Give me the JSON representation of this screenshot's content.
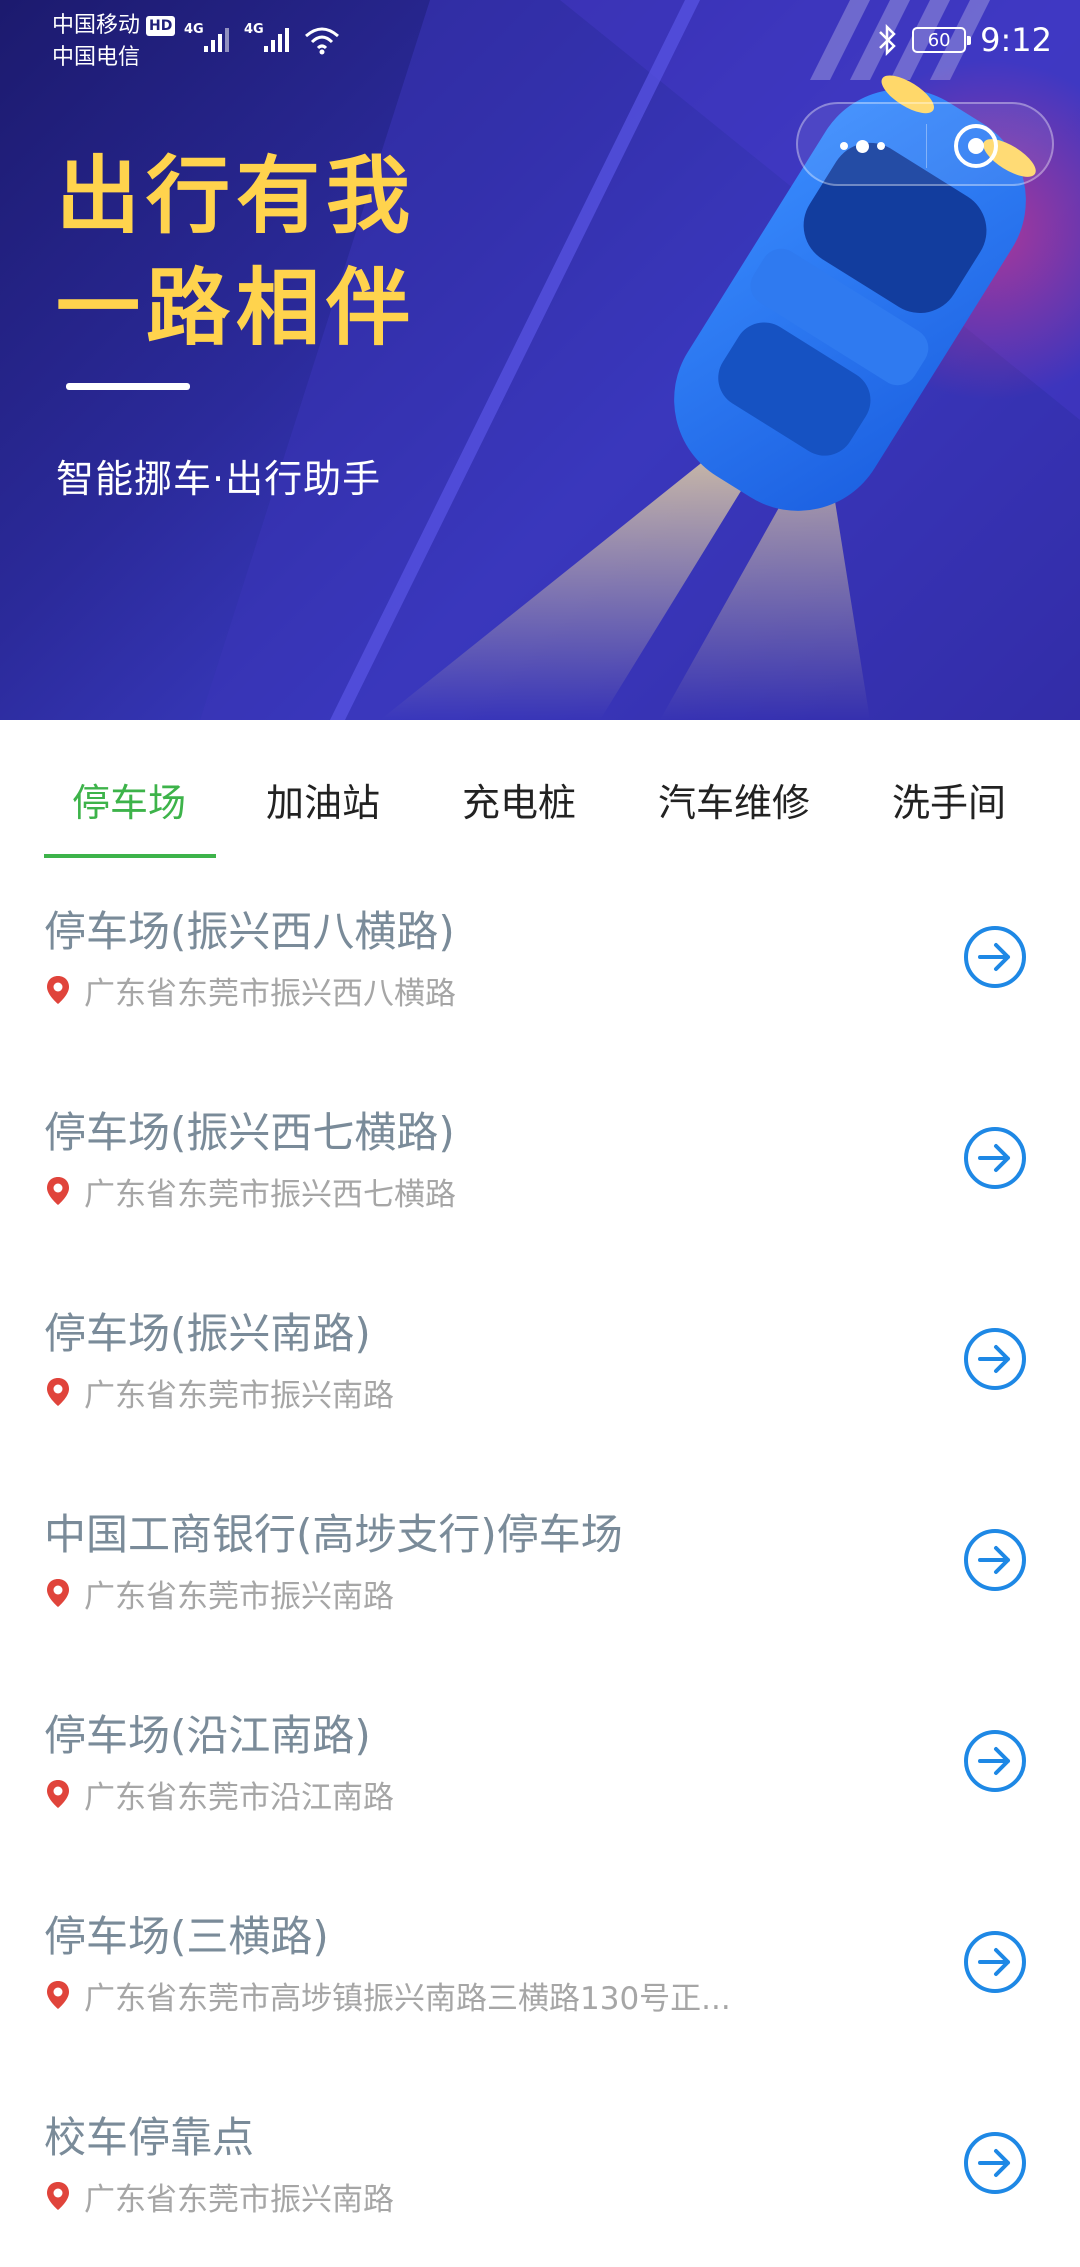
{
  "status_bar": {
    "carrier_1": "中国移动",
    "carrier_1_badge": "HD",
    "carrier_2": "中国电信",
    "network_1": "4G",
    "network_2": "4G",
    "battery": "60",
    "time": "9:12"
  },
  "hero": {
    "title_line_1": "出行有我",
    "title_line_2": "一路相伴",
    "subtitle": "智能挪车·出行助手",
    "colors": {
      "background": "#2b2a9a",
      "title": "#ffd34d"
    }
  },
  "tabs": [
    {
      "label": "停车场",
      "active": true
    },
    {
      "label": "加油站",
      "active": false
    },
    {
      "label": "充电桩",
      "active": false
    },
    {
      "label": "汽车维修",
      "active": false
    },
    {
      "label": "洗手间",
      "active": false
    }
  ],
  "accent_color": "#3db34a",
  "list_items": [
    {
      "name": "停车场(振兴西八横路)",
      "address": "广东省东莞市振兴西八横路"
    },
    {
      "name": "停车场(振兴西七横路)",
      "address": "广东省东莞市振兴西七横路"
    },
    {
      "name": "停车场(振兴南路)",
      "address": "广东省东莞市振兴南路"
    },
    {
      "name": "中国工商银行(高埗支行)停车场",
      "address": "广东省东莞市振兴南路"
    },
    {
      "name": "停车场(沿江南路)",
      "address": "广东省东莞市沿江南路"
    },
    {
      "name": "停车场(三横路)",
      "address": "广东省东莞市高埗镇振兴南路三横路130号正..."
    },
    {
      "name": "校车停靠点",
      "address": "广东省东莞市振兴南路"
    }
  ],
  "icons": {
    "location": "location-pin-icon",
    "navigate": "arrow-right-circle-icon"
  }
}
